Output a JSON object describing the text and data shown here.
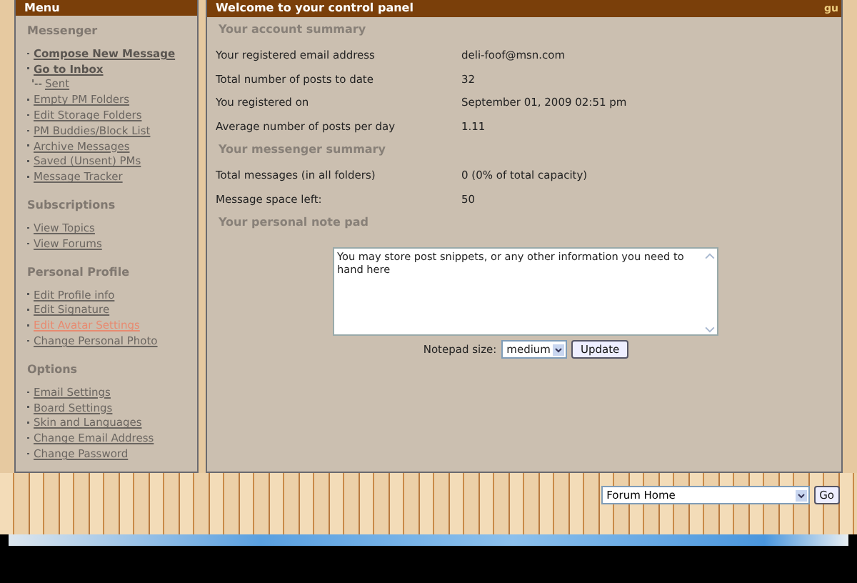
{
  "sidebar": {
    "title": "Menu",
    "sections": [
      {
        "title": "Messenger",
        "links": [
          {
            "label": "Compose New Message",
            "kind": "primary",
            "selected": false
          },
          {
            "label": "Go to Inbox",
            "kind": "primary",
            "selected": false
          },
          {
            "label": "Sent",
            "prefix": "'--",
            "kind": "sub",
            "selected": false
          },
          {
            "label": "Empty PM Folders",
            "kind": "plain",
            "selected": false
          },
          {
            "label": "Edit Storage Folders",
            "kind": "plain",
            "selected": false
          },
          {
            "label": "PM Buddies/Block List",
            "kind": "plain",
            "selected": false
          },
          {
            "label": "Archive Messages",
            "kind": "plain",
            "selected": false
          },
          {
            "label": "Saved (Unsent) PMs",
            "kind": "plain",
            "selected": false
          },
          {
            "label": "Message Tracker",
            "kind": "plain",
            "selected": false
          }
        ]
      },
      {
        "title": "Subscriptions",
        "links": [
          {
            "label": "View Topics",
            "kind": "plain",
            "selected": false
          },
          {
            "label": "View Forums",
            "kind": "plain",
            "selected": false
          }
        ]
      },
      {
        "title": "Personal Profile",
        "links": [
          {
            "label": "Edit Profile info",
            "kind": "plain",
            "selected": false
          },
          {
            "label": "Edit Signature",
            "kind": "plain",
            "selected": false
          },
          {
            "label": "Edit Avatar Settings",
            "kind": "plain",
            "selected": true
          },
          {
            "label": "Change Personal Photo",
            "kind": "plain",
            "selected": false
          }
        ]
      },
      {
        "title": "Options",
        "links": [
          {
            "label": "Email Settings",
            "kind": "plain",
            "selected": false
          },
          {
            "label": "Board Settings",
            "kind": "plain",
            "selected": false
          },
          {
            "label": "Skin and Languages",
            "kind": "plain",
            "selected": false
          },
          {
            "label": "Change Email Address",
            "kind": "plain",
            "selected": false
          },
          {
            "label": "Change Password",
            "kind": "plain",
            "selected": false
          }
        ]
      }
    ]
  },
  "main": {
    "title": "Welcome to your control panel",
    "corner_text": "gu",
    "sections": [
      {
        "title": "Your account summary",
        "rows": [
          {
            "label": "Your registered email address",
            "value": "deli-foof@msn.com"
          },
          {
            "label": "Total number of posts to date",
            "value": "32"
          },
          {
            "label": "You registered on",
            "value": "September 01, 2009 02:51 pm"
          },
          {
            "label": "Average number of posts per day",
            "value": "1.11"
          }
        ]
      },
      {
        "title": "Your messenger summary",
        "rows": [
          {
            "label": "Total messages (in all folders)",
            "value": "0 (0% of total capacity)"
          },
          {
            "label": "Message space left:",
            "value": "50"
          }
        ]
      }
    ],
    "notepad": {
      "title": "Your personal note pad",
      "text": "You may store post snippets, or any other information you need to hand here",
      "size_label": "Notepad size:",
      "size_value": "medium",
      "button": "Update"
    }
  },
  "footer": {
    "jump_value": "Forum Home",
    "jump_button": "Go"
  }
}
